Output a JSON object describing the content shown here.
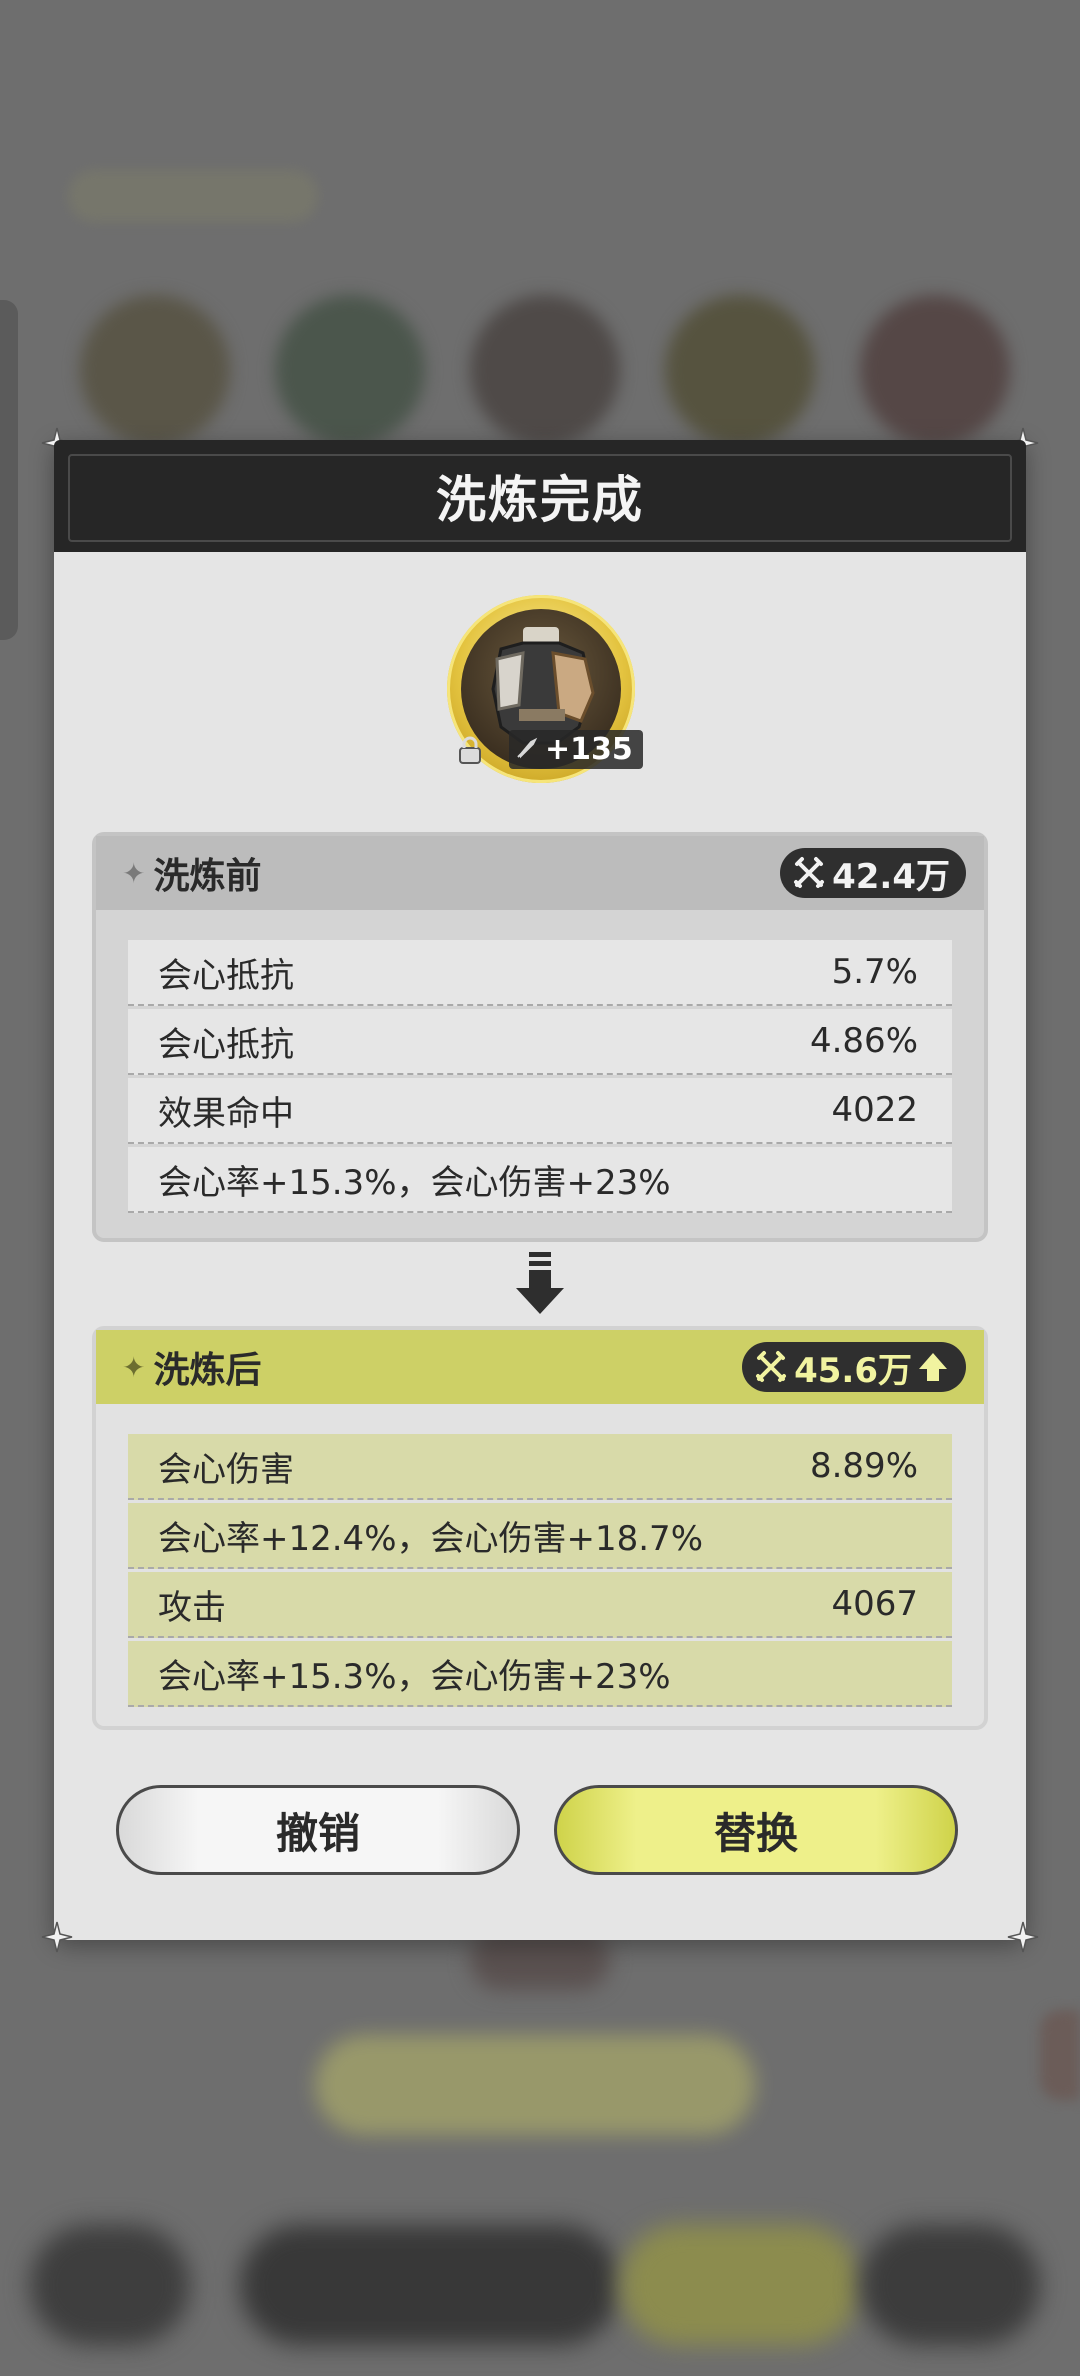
{
  "dialog": {
    "title": "洗炼完成",
    "item": {
      "level": "+135"
    },
    "before": {
      "label": "洗炼前",
      "power": "42.4万",
      "stats": [
        {
          "name": "会心抵抗",
          "value": "5.7%"
        },
        {
          "name": "会心抵抗",
          "value": "4.86%"
        },
        {
          "name": "效果命中",
          "value": "4022"
        },
        {
          "name": "会心率+15.3%，会心伤害+23%",
          "value": ""
        }
      ]
    },
    "after": {
      "label": "洗炼后",
      "power": "45.6万",
      "stats": [
        {
          "name": "会心伤害",
          "value": "8.89%"
        },
        {
          "name": "会心率+12.4%，会心伤害+18.7%",
          "value": ""
        },
        {
          "name": "攻击",
          "value": "4067"
        },
        {
          "name": "会心率+15.3%，会心伤害+23%",
          "value": ""
        }
      ]
    },
    "buttons": {
      "cancel": "撤销",
      "replace": "替换"
    }
  },
  "colors": {
    "accent": "#cdd066",
    "header": "#262626",
    "power_badge": "#2f2f2f"
  },
  "icons": [
    "corner-ornament-icon",
    "lock-icon",
    "sword-icon",
    "power-icon",
    "arrow-up-icon",
    "arrow-down-icon",
    "star-icon"
  ]
}
